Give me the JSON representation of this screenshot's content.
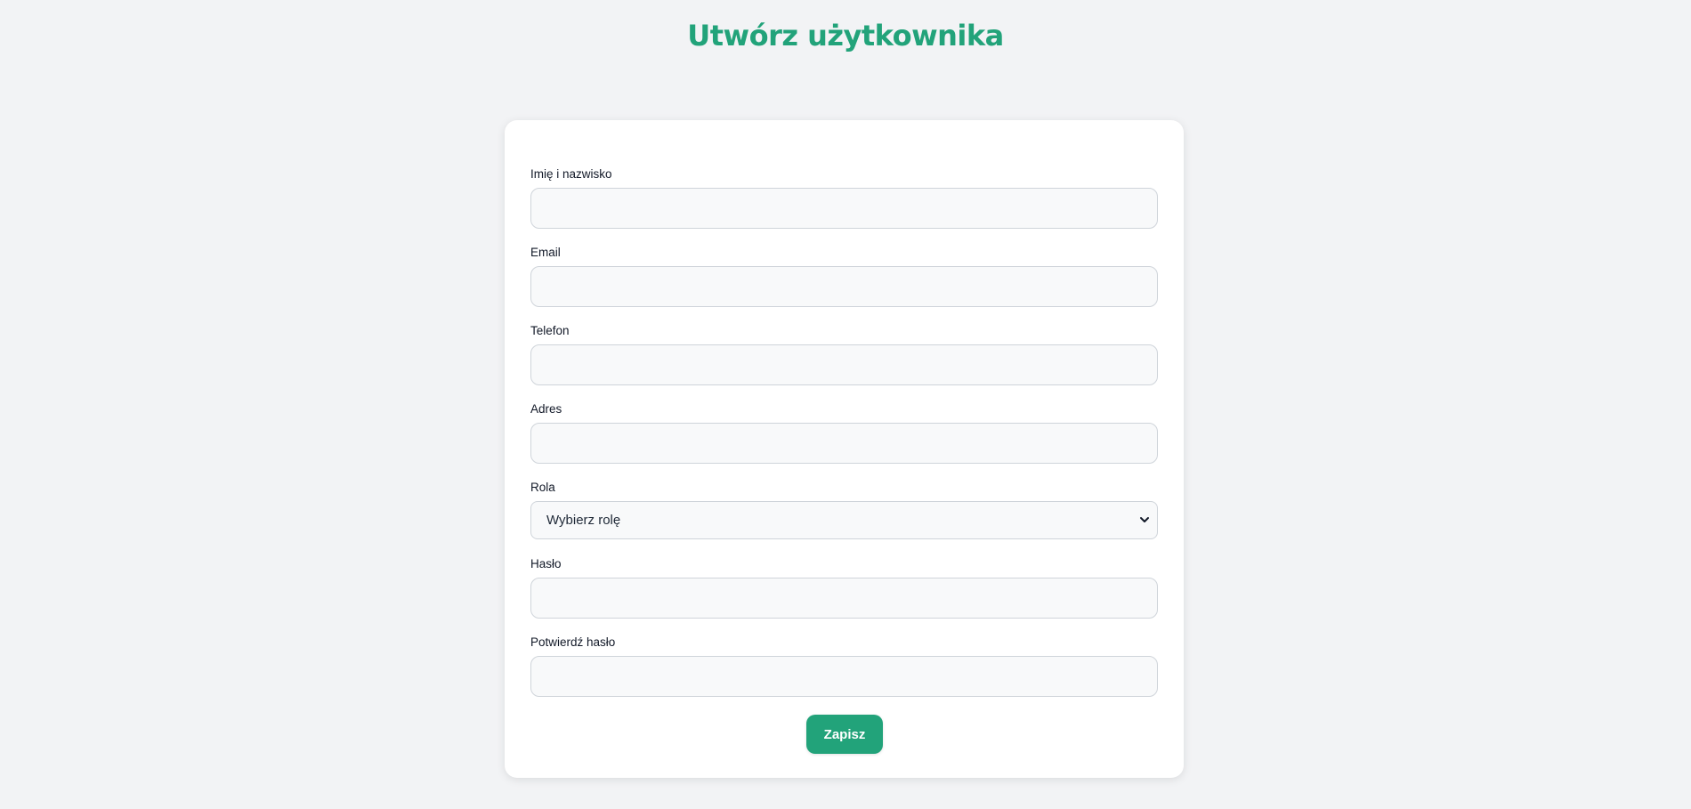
{
  "page": {
    "title": "Utwórz użytkownika"
  },
  "form": {
    "fields": [
      {
        "label": "Imię i nazwisko",
        "value": "",
        "placeholder": ""
      },
      {
        "label": "Email",
        "value": "",
        "placeholder": ""
      },
      {
        "label": "Telefon",
        "value": "",
        "placeholder": ""
      },
      {
        "label": "Adres",
        "value": "",
        "placeholder": ""
      }
    ],
    "role": {
      "label": "Rola",
      "selected": "Wybierz rolę"
    },
    "password": {
      "label": "Hasło",
      "value": ""
    },
    "confirm_password": {
      "label": "Potwierdź hasło",
      "value": ""
    },
    "submit_label": "Zapisz"
  },
  "colors": {
    "accent": "#22a37a",
    "background": "#f2f3f5",
    "card": "#ffffff",
    "input_bg": "#f8f9fa",
    "input_border": "#cfd4da"
  },
  "icons": {
    "select_chevron": "chevron-down-icon"
  }
}
